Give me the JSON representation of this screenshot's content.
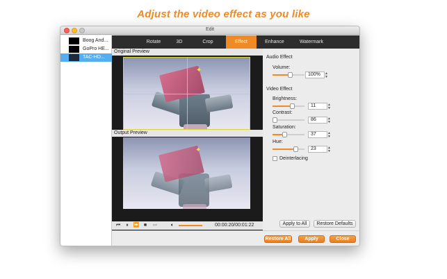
{
  "headline": "Adjust the video effect as you like",
  "window": {
    "title": "Edit"
  },
  "files": [
    {
      "name": "Boog And..."
    },
    {
      "name": "GoPro HE..."
    },
    {
      "name": "TAC-HD...",
      "selected": true
    }
  ],
  "tabs": [
    {
      "label": "Rotate"
    },
    {
      "label": "3D"
    },
    {
      "label": "Crop"
    },
    {
      "label": "Effect",
      "active": true
    },
    {
      "label": "Enhance"
    },
    {
      "label": "Watermark"
    }
  ],
  "preview": {
    "original_label": "Original Preview",
    "output_label": "Output Preview"
  },
  "player": {
    "timecode": "00:00:20/00:01:22",
    "progress": 0.24
  },
  "audio_effect": {
    "title": "Audio Effect",
    "volume_label": "Volume:",
    "volume_value": "100%"
  },
  "video_effect": {
    "title": "Video Effect",
    "brightness_label": "Brightness:",
    "brightness_value": "11",
    "contrast_label": "Contrast:",
    "contrast_value": "86",
    "saturation_label": "Saturation:",
    "saturation_value": "37",
    "hue_label": "Hue:",
    "hue_value": "23",
    "deinterlacing_label": "Deinterlacing"
  },
  "buttons": {
    "apply_to_all": "Apply to All",
    "restore_defaults": "Restore Defaults",
    "restore_all": "Restore All",
    "apply": "Apply",
    "close": "Close"
  },
  "colors": {
    "accent": "#f08a24",
    "tabbar": "#2d2d2d",
    "selection": "#54aef0"
  }
}
